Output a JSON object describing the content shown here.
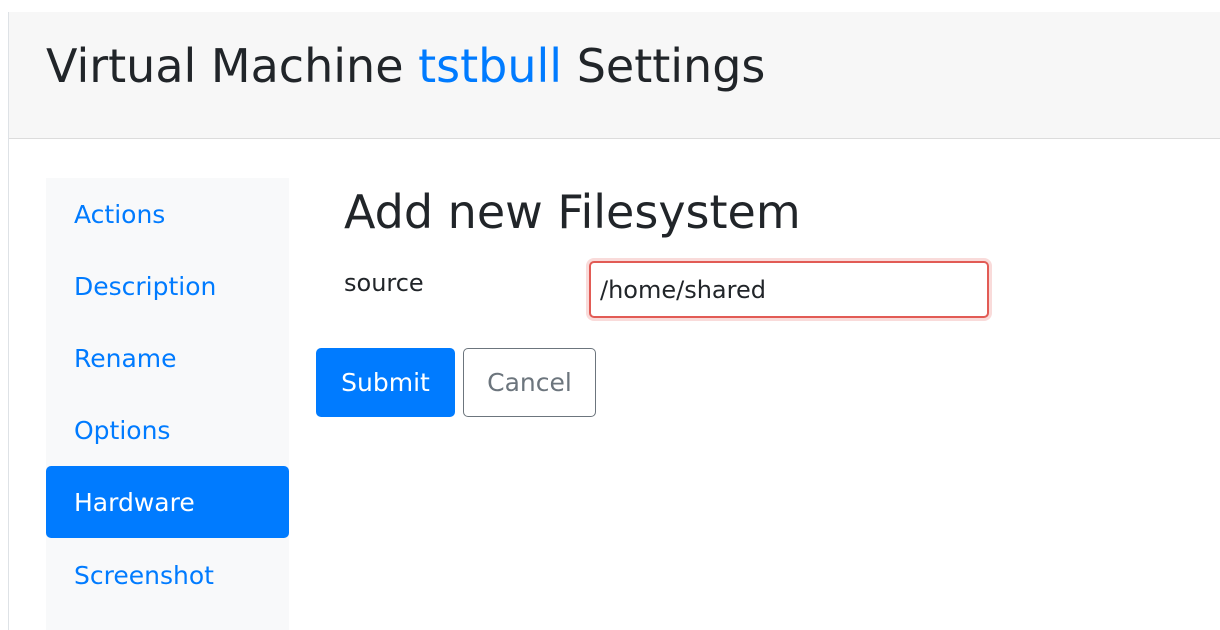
{
  "header": {
    "title_prefix": "Virtual Machine",
    "vm_name": "tstbull",
    "title_suffix": "Settings"
  },
  "sidebar": {
    "items": [
      {
        "label": "Actions",
        "active": false
      },
      {
        "label": "Description",
        "active": false
      },
      {
        "label": "Rename",
        "active": false
      },
      {
        "label": "Options",
        "active": false
      },
      {
        "label": "Hardware",
        "active": true
      },
      {
        "label": "Screenshot",
        "active": false
      }
    ]
  },
  "form": {
    "title": "Add new Filesystem",
    "source_label": "source",
    "source_value": "/home/shared",
    "submit_label": "Submit",
    "cancel_label": "Cancel"
  },
  "colors": {
    "accent": "#007bff",
    "input_error_border": "#e25b55",
    "header_bg": "#f7f7f7",
    "sidebar_bg": "#f8f9fa"
  }
}
